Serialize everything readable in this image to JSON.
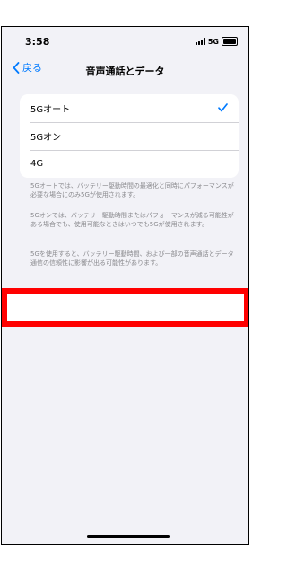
{
  "status_bar": {
    "time": "3:58",
    "network": "5G",
    "icons": [
      "signal-icon",
      "battery-icon"
    ]
  },
  "nav": {
    "back_label": "戻る",
    "title": "音声通話とデータ",
    "back_icon": "chevron-left-icon"
  },
  "options": [
    {
      "label": "5Gオート",
      "selected": true
    },
    {
      "label": "5Gオン",
      "selected": false
    },
    {
      "label": "4G",
      "selected": false
    }
  ],
  "footnotes": [
    "5Gオートでは、バッテリー駆動時間の最適化と同時にパフォーマンスが必要な場合にのみ5Gが使用されます。",
    "5Gオンでは、バッテリー駆動時間またはパフォーマンスが減る可能性がある場合でも、使用可能なときはいつでも5Gが使用されます。",
    "5Gを使用すると、バッテリー駆動時間、および一部の音声通話とデータ通信の信頼性に影響が出る可能性があります。"
  ],
  "colors": {
    "accent": "#007aff",
    "background": "#f2f2f7",
    "highlight": "#ff0000"
  }
}
